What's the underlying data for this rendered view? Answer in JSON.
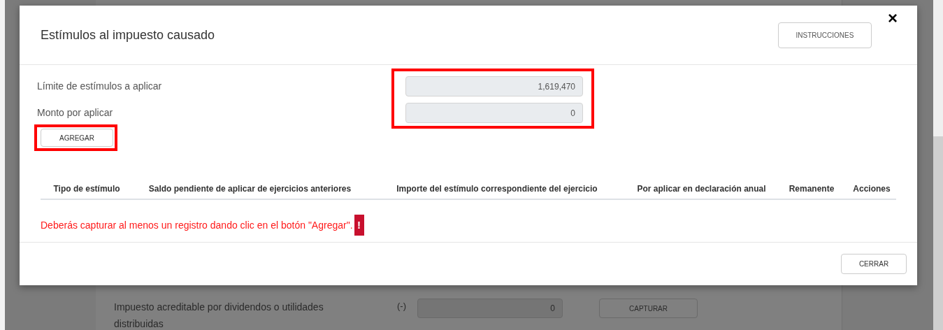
{
  "dialog": {
    "title": "Estímulos al impuesto causado",
    "instructions_button": "INSTRUCCIONES",
    "close_button": "×",
    "fields": [
      {
        "label": "Límite de estímulos a aplicar",
        "value": "1,619,470"
      },
      {
        "label": "Monto por aplicar",
        "value": "0"
      }
    ],
    "add_button": "AGREGAR",
    "table": {
      "columns": [
        "Tipo de estímulo",
        "Saldo pendiente de aplicar de ejercicios anteriores",
        "Importe del estímulo correspondiente del ejercicio",
        "Por aplicar en declaración anual",
        "Remanente",
        "Acciones"
      ]
    },
    "error": {
      "message": "Deberás capturar al menos un registro dando clic en el botón \"Agregar\".",
      "badge": "!"
    },
    "footer_button": "CERRAR"
  },
  "background": {
    "rows": [
      {
        "label": "Impuesto acreditable por dividendos o utilidades distribuidas",
        "sign": "(-)",
        "value": "0",
        "button": "CAPTURAR"
      }
    ]
  }
}
